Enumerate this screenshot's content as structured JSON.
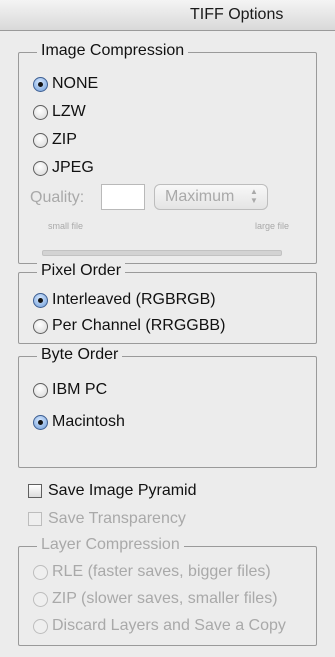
{
  "window": {
    "title": "TIFF Options"
  },
  "image_compression": {
    "legend": "Image Compression",
    "options": [
      {
        "label": "NONE",
        "selected": true
      },
      {
        "label": "LZW",
        "selected": false
      },
      {
        "label": "ZIP",
        "selected": false
      },
      {
        "label": "JPEG",
        "selected": false
      }
    ],
    "quality_label": "Quality:",
    "quality_value": "",
    "quality_select": "Maximum",
    "small_file_label": "small file",
    "large_file_label": "large file"
  },
  "pixel_order": {
    "legend": "Pixel Order",
    "options": [
      {
        "label": "Interleaved (RGBRGB)",
        "selected": true
      },
      {
        "label": "Per Channel (RRGGBB)",
        "selected": false
      }
    ]
  },
  "byte_order": {
    "legend": "Byte Order",
    "options": [
      {
        "label": "IBM PC",
        "selected": false
      },
      {
        "label": "Macintosh",
        "selected": true
      }
    ]
  },
  "checkboxes": {
    "save_image_pyramid": {
      "label": "Save Image Pyramid",
      "checked": false
    },
    "save_transparency": {
      "label": "Save Transparency",
      "checked": false,
      "disabled": true
    }
  },
  "layer_compression": {
    "legend": "Layer Compression",
    "options": [
      {
        "label": "RLE (faster saves, bigger files)",
        "selected": false
      },
      {
        "label": "ZIP (slower saves, smaller files)",
        "selected": false
      },
      {
        "label": "Discard Layers and Save a Copy",
        "selected": false
      }
    ]
  }
}
